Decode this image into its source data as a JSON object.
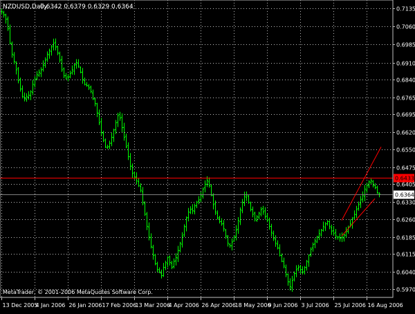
{
  "header": {
    "symbol_label": "NZDUSD,Daily",
    "ohlc": "0.6342 0.6379 0.6329 0.6364"
  },
  "footer": {
    "copyright": "MetaTrader, © 2001-2006 MetaQuotes Software Corp."
  },
  "colors": {
    "background": "#000000",
    "frame": "#c0c0c0",
    "grid": "#c0c0c0",
    "bar": "#00ff00",
    "hline": "#ff0000",
    "channel": "#ff0000",
    "price_tag": "#c0c0c0",
    "text": "#ffffff"
  },
  "chart_data": {
    "type": "bar",
    "style": "OHLC bars",
    "grid": true,
    "ylim": [
      0.5935,
      0.717
    ],
    "y_ticks": [
      "0.7135",
      "0.7060",
      "0.6985",
      "0.6910",
      "0.6840",
      "0.6765",
      "0.6695",
      "0.6620",
      "0.6550",
      "0.6475",
      "0.6405",
      "0.6330",
      "0.6260",
      "0.6185",
      "0.6115",
      "0.6040",
      "0.5970"
    ],
    "x_ticks": [
      "13 Dec 2005",
      "4 Jan 2006",
      "26 Jan 2006",
      "17 Feb 2006",
      "13 Mar 2006",
      "4 Apr 2006",
      "26 Apr 2006",
      "18 May 2006",
      "9 Jun 2006",
      "3 Jul 2006",
      "25 Jul 2006",
      "16 Aug 2006"
    ],
    "bars_per_tick": 16,
    "series_close": [
      0.7122,
      0.7108,
      0.709,
      0.705,
      0.699,
      0.6945,
      0.6915,
      0.688,
      0.6835,
      0.68,
      0.677,
      0.676,
      0.677,
      0.6775,
      0.679,
      0.682,
      0.684,
      0.686,
      0.687,
      0.688,
      0.69,
      0.692,
      0.6945,
      0.696,
      0.6975,
      0.699,
      0.6975,
      0.695,
      0.692,
      0.688,
      0.6855,
      0.6845,
      0.685,
      0.6865,
      0.688,
      0.69,
      0.691,
      0.6895,
      0.687,
      0.684,
      0.682,
      0.6815,
      0.6805,
      0.679,
      0.676,
      0.674,
      0.67,
      0.666,
      0.662,
      0.6585,
      0.656,
      0.656,
      0.6575,
      0.66,
      0.663,
      0.666,
      0.669,
      0.668,
      0.664,
      0.66,
      0.656,
      0.652,
      0.648,
      0.645,
      0.6435,
      0.642,
      0.64,
      0.638,
      0.633,
      0.628,
      0.623,
      0.6185,
      0.6145,
      0.611,
      0.6075,
      0.605,
      0.604,
      0.6025,
      0.606,
      0.608,
      0.61,
      0.608,
      0.606,
      0.6085,
      0.61,
      0.613,
      0.616,
      0.619,
      0.623,
      0.6265,
      0.629,
      0.63,
      0.6295,
      0.6315,
      0.633,
      0.634,
      0.636,
      0.6385,
      0.6405,
      0.642,
      0.64,
      0.636,
      0.632,
      0.629,
      0.6265,
      0.625,
      0.624,
      0.622,
      0.619,
      0.616,
      0.615,
      0.6165,
      0.6185,
      0.6215,
      0.6255,
      0.63,
      0.633,
      0.6355,
      0.636,
      0.633,
      0.63,
      0.628,
      0.626,
      0.627,
      0.6285,
      0.63,
      0.629,
      0.627,
      0.6255,
      0.623,
      0.6205,
      0.618,
      0.616,
      0.614,
      0.611,
      0.6085,
      0.6065,
      0.603,
      0.6,
      0.598,
      0.6005,
      0.6035,
      0.605,
      0.606,
      0.605,
      0.604,
      0.606,
      0.6085,
      0.611,
      0.6135,
      0.6155,
      0.617,
      0.6185,
      0.62,
      0.6215,
      0.623,
      0.624,
      0.625,
      0.623,
      0.621,
      0.62,
      0.619,
      0.6185,
      0.618,
      0.6185,
      0.6195,
      0.621,
      0.6225,
      0.624,
      0.626,
      0.628,
      0.63,
      0.632,
      0.634,
      0.636,
      0.6385,
      0.64,
      0.6415,
      0.642,
      0.64,
      0.639,
      0.637,
      0.6364
    ],
    "horizontal_lines": [
      {
        "value": 0.6433,
        "label": "0.6433"
      },
      {
        "value": 0.6364,
        "label": "0.6364"
      }
    ],
    "channel_lines": [
      {
        "from_bar": 164,
        "from_value": 0.6255,
        "to_bar": 183,
        "to_value": 0.656
      },
      {
        "from_bar": 164,
        "from_value": 0.619,
        "to_bar": 180,
        "to_value": 0.6345
      }
    ]
  }
}
